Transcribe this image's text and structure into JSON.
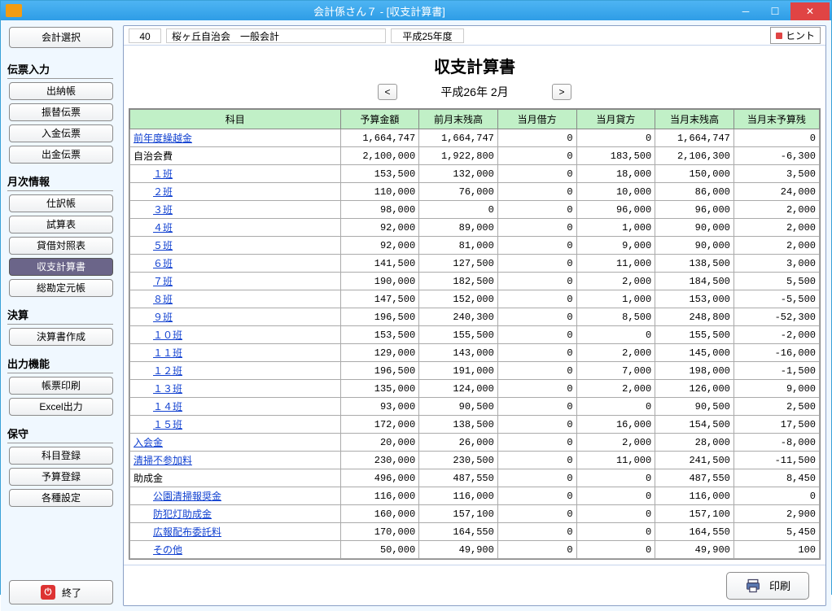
{
  "window": {
    "title": "会計係さん７ - [収支計算書]"
  },
  "sidebar": {
    "select_btn": "会計選択",
    "sections": {
      "denpyo": {
        "title": "伝票入力",
        "items": [
          "出納帳",
          "振替伝票",
          "入金伝票",
          "出金伝票"
        ]
      },
      "getsuji": {
        "title": "月次情報",
        "items": [
          "仕訳帳",
          "試算表",
          "貸借対照表",
          "収支計算書",
          "総勘定元帳"
        ],
        "active_index": 3
      },
      "kessan": {
        "title": "決算",
        "items": [
          "決算書作成"
        ]
      },
      "output": {
        "title": "出力機能",
        "items": [
          "帳票印刷",
          "Excel出力"
        ]
      },
      "hoshu": {
        "title": "保守",
        "items": [
          "科目登録",
          "予算登録",
          "各種設定"
        ]
      }
    },
    "quit": "終了"
  },
  "topbar": {
    "org_no": "40",
    "org_name": "桜ヶ丘自治会　一般会計",
    "fiscal_year": "平成25年度",
    "hint": "ヒント"
  },
  "heading": "収支計算書",
  "month_nav": {
    "period": "平成26年 2月"
  },
  "table": {
    "headers": [
      "科目",
      "予算金額",
      "前月末残高",
      "当月借方",
      "当月貸方",
      "当月末残高",
      "当月末予算残"
    ],
    "rows": [
      {
        "label": "前年度繰越金",
        "link": true,
        "indent": 0,
        "vals": [
          "1,664,747",
          "1,664,747",
          "0",
          "0",
          "1,664,747",
          "0"
        ]
      },
      {
        "label": "自治会費",
        "link": false,
        "indent": 0,
        "vals": [
          "2,100,000",
          "1,922,800",
          "0",
          "183,500",
          "2,106,300",
          "-6,300"
        ]
      },
      {
        "label": "１班",
        "link": true,
        "indent": 1,
        "vals": [
          "153,500",
          "132,000",
          "0",
          "18,000",
          "150,000",
          "3,500"
        ]
      },
      {
        "label": "２班",
        "link": true,
        "indent": 1,
        "vals": [
          "110,000",
          "76,000",
          "0",
          "10,000",
          "86,000",
          "24,000"
        ]
      },
      {
        "label": "３班",
        "link": true,
        "indent": 1,
        "vals": [
          "98,000",
          "0",
          "0",
          "96,000",
          "96,000",
          "2,000"
        ]
      },
      {
        "label": "４班",
        "link": true,
        "indent": 1,
        "vals": [
          "92,000",
          "89,000",
          "0",
          "1,000",
          "90,000",
          "2,000"
        ]
      },
      {
        "label": "５班",
        "link": true,
        "indent": 1,
        "vals": [
          "92,000",
          "81,000",
          "0",
          "9,000",
          "90,000",
          "2,000"
        ]
      },
      {
        "label": "６班",
        "link": true,
        "indent": 1,
        "vals": [
          "141,500",
          "127,500",
          "0",
          "11,000",
          "138,500",
          "3,000"
        ]
      },
      {
        "label": "７班",
        "link": true,
        "indent": 1,
        "vals": [
          "190,000",
          "182,500",
          "0",
          "2,000",
          "184,500",
          "5,500"
        ]
      },
      {
        "label": "８班",
        "link": true,
        "indent": 1,
        "vals": [
          "147,500",
          "152,000",
          "0",
          "1,000",
          "153,000",
          "-5,500"
        ]
      },
      {
        "label": "９班",
        "link": true,
        "indent": 1,
        "vals": [
          "196,500",
          "240,300",
          "0",
          "8,500",
          "248,800",
          "-52,300"
        ]
      },
      {
        "label": "１０班",
        "link": true,
        "indent": 1,
        "vals": [
          "153,500",
          "155,500",
          "0",
          "0",
          "155,500",
          "-2,000"
        ]
      },
      {
        "label": "１１班",
        "link": true,
        "indent": 1,
        "vals": [
          "129,000",
          "143,000",
          "0",
          "2,000",
          "145,000",
          "-16,000"
        ]
      },
      {
        "label": "１２班",
        "link": true,
        "indent": 1,
        "vals": [
          "196,500",
          "191,000",
          "0",
          "7,000",
          "198,000",
          "-1,500"
        ]
      },
      {
        "label": "１３班",
        "link": true,
        "indent": 1,
        "vals": [
          "135,000",
          "124,000",
          "0",
          "2,000",
          "126,000",
          "9,000"
        ]
      },
      {
        "label": "１４班",
        "link": true,
        "indent": 1,
        "vals": [
          "93,000",
          "90,500",
          "0",
          "0",
          "90,500",
          "2,500"
        ]
      },
      {
        "label": "１５班",
        "link": true,
        "indent": 1,
        "vals": [
          "172,000",
          "138,500",
          "0",
          "16,000",
          "154,500",
          "17,500"
        ]
      },
      {
        "label": "入会金",
        "link": true,
        "indent": 0,
        "vals": [
          "20,000",
          "26,000",
          "0",
          "2,000",
          "28,000",
          "-8,000"
        ]
      },
      {
        "label": "清掃不参加料",
        "link": true,
        "indent": 0,
        "vals": [
          "230,000",
          "230,500",
          "0",
          "11,000",
          "241,500",
          "-11,500"
        ]
      },
      {
        "label": "助成金",
        "link": false,
        "indent": 0,
        "vals": [
          "496,000",
          "487,550",
          "0",
          "0",
          "487,550",
          "8,450"
        ]
      },
      {
        "label": "公園清掃報奨金",
        "link": true,
        "indent": 1,
        "vals": [
          "116,000",
          "116,000",
          "0",
          "0",
          "116,000",
          "0"
        ]
      },
      {
        "label": "防犯灯助成金",
        "link": true,
        "indent": 1,
        "vals": [
          "160,000",
          "157,100",
          "0",
          "0",
          "157,100",
          "2,900"
        ]
      },
      {
        "label": "広報配布委託料",
        "link": true,
        "indent": 1,
        "vals": [
          "170,000",
          "164,550",
          "0",
          "0",
          "164,550",
          "5,450"
        ]
      },
      {
        "label": "その他",
        "link": true,
        "indent": 1,
        "vals": [
          "50,000",
          "49,900",
          "0",
          "0",
          "49,900",
          "100"
        ]
      }
    ]
  },
  "buttons": {
    "print": "印刷"
  }
}
